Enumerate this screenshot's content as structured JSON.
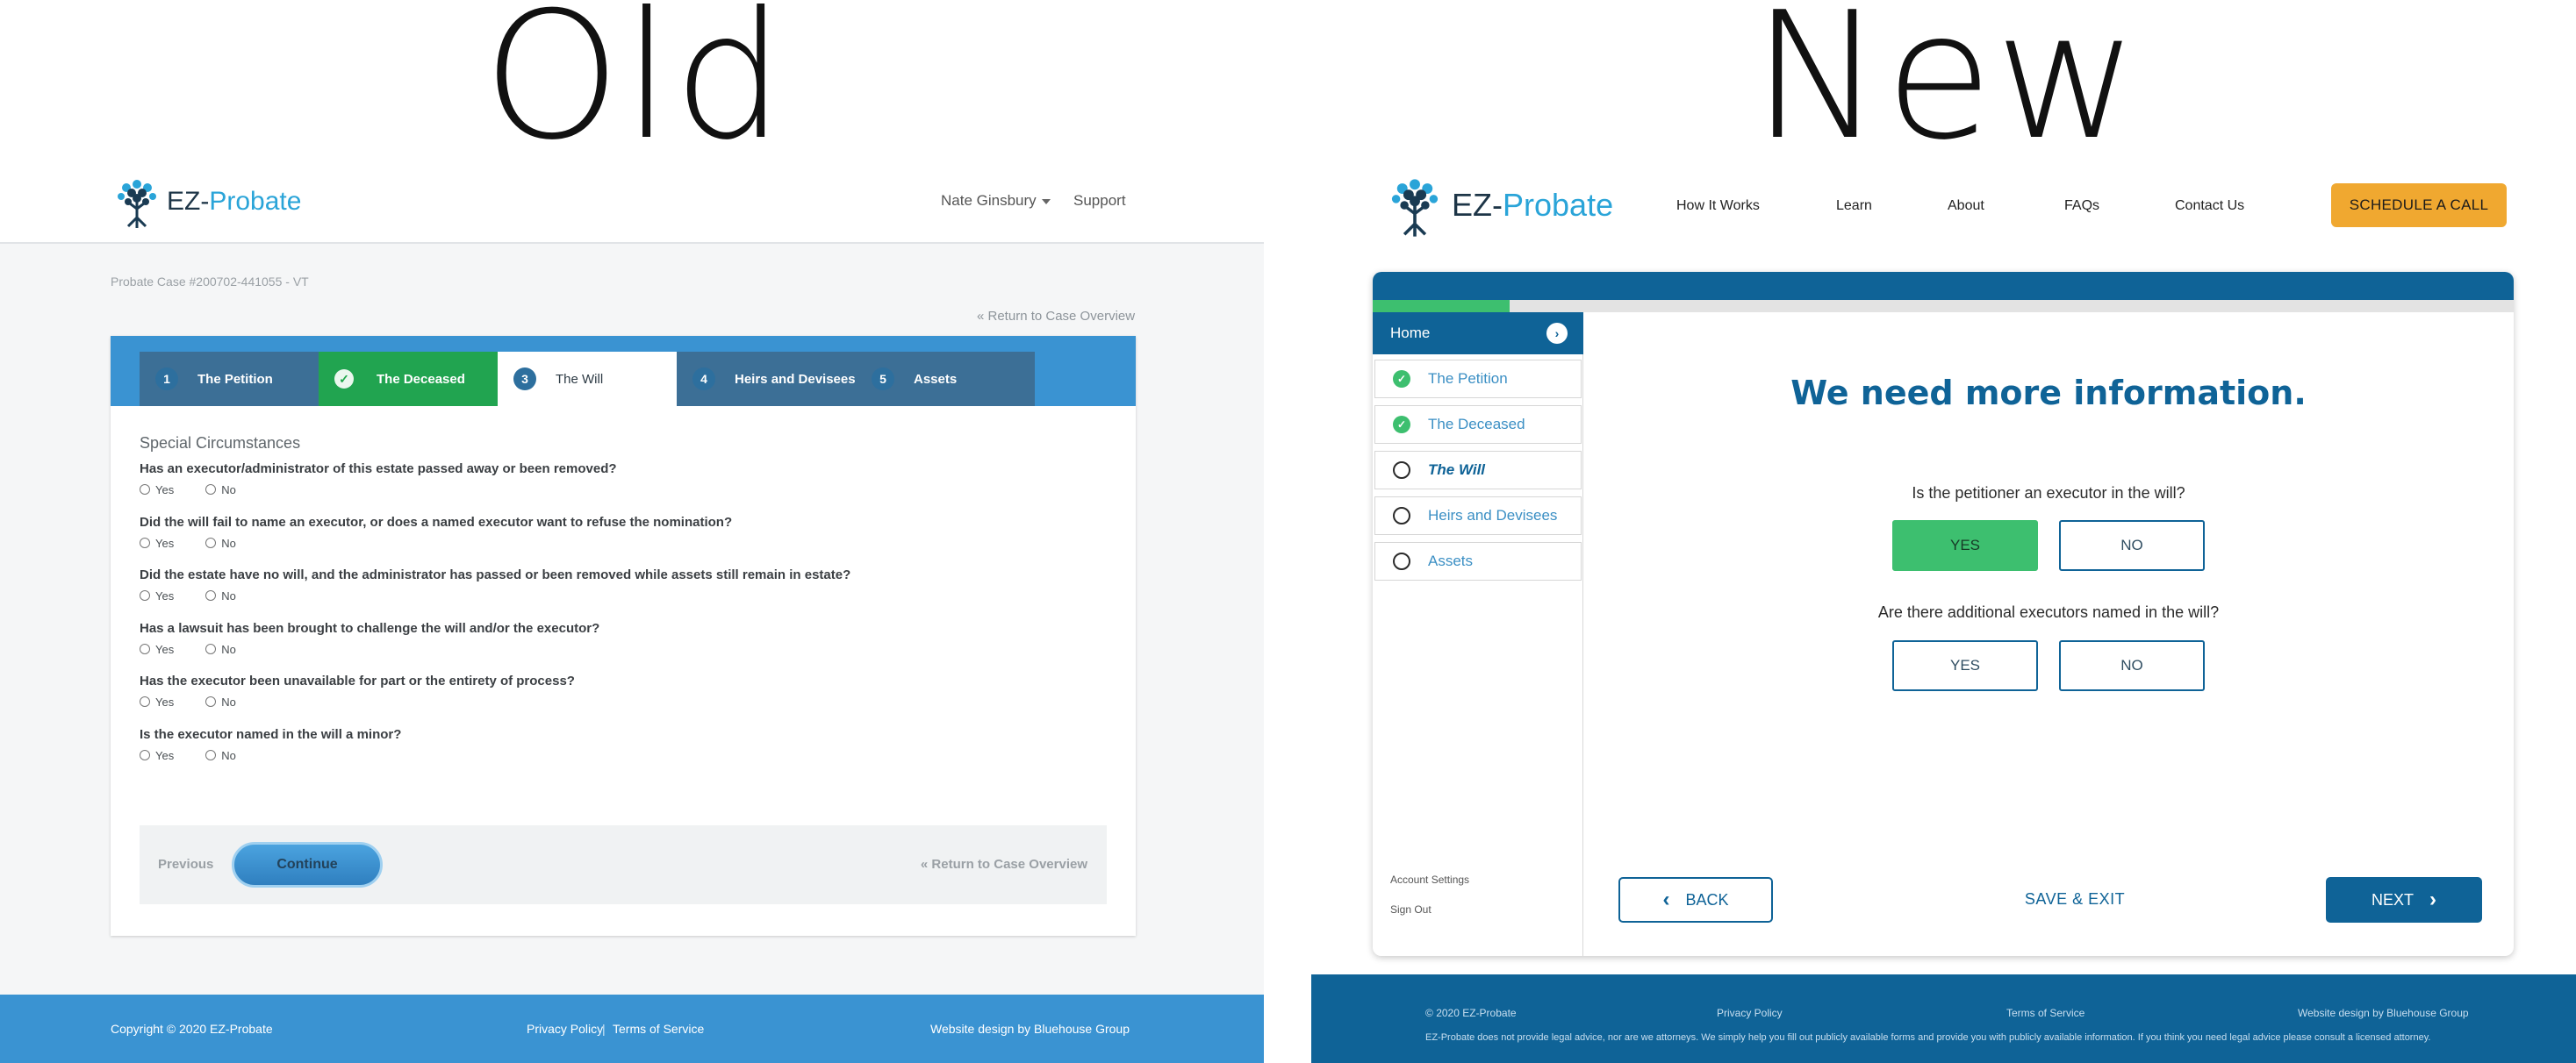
{
  "titles": {
    "old": "Old",
    "new": "New"
  },
  "old": {
    "logo": {
      "prefix": "EZ-",
      "name": "Probate"
    },
    "nav": {
      "user": "Nate Ginsbury",
      "support": "Support"
    },
    "case_id": "Probate Case #200702-441055 - VT",
    "return_link": "« Return to Case Overview",
    "tabs": [
      {
        "num": "1",
        "label": "The Petition"
      },
      {
        "num": "",
        "label": "The Deceased"
      },
      {
        "num": "3",
        "label": "The Will"
      },
      {
        "num": "4",
        "label": "Heirs and Devisees"
      },
      {
        "num": "5",
        "label": "Assets"
      }
    ],
    "section_title": "Special Circumstances",
    "option_yes": "Yes",
    "option_no": "No",
    "questions": [
      "Has an executor/administrator of this estate passed away or been removed?",
      "Did the will fail to name an executor, or does a named executor want to refuse the nomination?",
      "Did the estate have no will, and the administrator has passed or been removed while assets still remain in estate?",
      "Has a lawsuit has been brought to challenge the will and/or the executor?",
      "Has the executor been unavailable for part or the entirety of process?",
      "Is the executor named in the will a minor?"
    ],
    "previous": "Previous",
    "continue": "Continue",
    "footer": {
      "copyright": "Copyright © 2020 EZ-Probate",
      "privacy": "Privacy Policy",
      "sep": "|",
      "terms": "Terms of Service",
      "design": "Website design by Bluehouse Group"
    }
  },
  "new": {
    "logo": {
      "prefix": "EZ-",
      "name": "Probate"
    },
    "nav": [
      "How It Works",
      "Learn",
      "About",
      "FAQs",
      "Contact Us"
    ],
    "schedule": "SCHEDULE A CALL",
    "progress_fraction": 0.12,
    "sidebar": {
      "home": "Home",
      "items": [
        {
          "label": "The Petition",
          "status": "done"
        },
        {
          "label": "The Deceased",
          "status": "done"
        },
        {
          "label": "The Will",
          "status": "current"
        },
        {
          "label": "Heirs and Devisees",
          "status": "todo"
        },
        {
          "label": "Assets",
          "status": "todo"
        }
      ],
      "account": "Account Settings",
      "signout": "Sign Out"
    },
    "heading": "We need more information.",
    "q1": {
      "text": "Is the petitioner an executor in the will?",
      "yes": "YES",
      "no": "NO",
      "selected": "yes"
    },
    "q2": {
      "text": "Are there additional executors named in the will?",
      "yes": "YES",
      "no": "NO",
      "selected": ""
    },
    "back": "BACK",
    "save": "SAVE & EXIT",
    "next": "NEXT",
    "footer": {
      "copyright": "2020 EZ-Probate",
      "privacy": "Privacy Policy",
      "terms": "Terms of Service",
      "design": "Website design by Bluehouse Group",
      "disclaimer": "EZ-Probate does not provide legal advice, nor are we attorneys.  We simply help you fill out publicly available forms and provide you with publicly available information.  If you think you need legal advice please consult a licensed attorney."
    }
  },
  "colors": {
    "old_blue": "#3a93d2",
    "old_green": "#21a450",
    "new_blue": "#0f6397",
    "new_green": "#3dbf6f",
    "cta": "#f0a830"
  }
}
